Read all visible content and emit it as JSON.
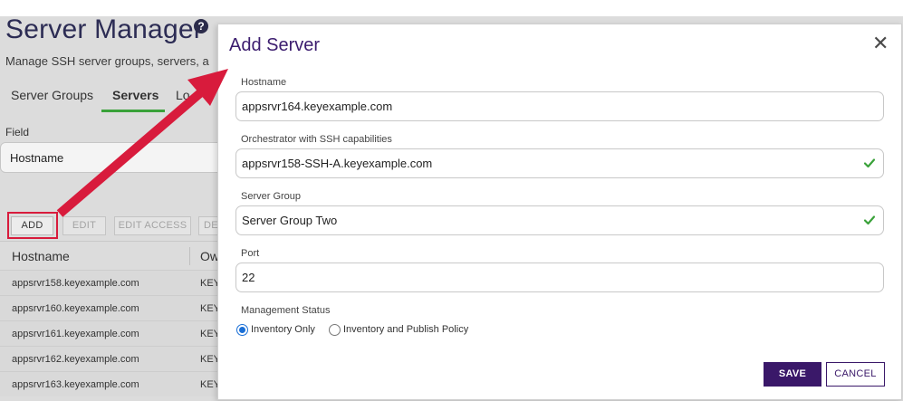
{
  "page": {
    "title": "Server Manager",
    "subtitle": "Manage SSH server groups, servers, a",
    "help_glyph": "?"
  },
  "tabs": [
    {
      "label": "Server Groups",
      "active": false
    },
    {
      "label": "Servers",
      "active": true
    },
    {
      "label": "Lo",
      "active": false
    }
  ],
  "filter": {
    "label": "Field",
    "value": "Hostname"
  },
  "actions": {
    "add": "ADD",
    "edit": "EDIT",
    "edit_access": "EDIT ACCESS",
    "delete_partial": "DE"
  },
  "grid": {
    "columns": [
      "Hostname",
      "Ow"
    ],
    "rows": [
      {
        "hostname": "appsrvr158.keyexample.com",
        "owner": "KEY"
      },
      {
        "hostname": "appsrvr160.keyexample.com",
        "owner": "KEY"
      },
      {
        "hostname": "appsrvr161.keyexample.com",
        "owner": "KEY"
      },
      {
        "hostname": "appsrvr162.keyexample.com",
        "owner": "KEY"
      },
      {
        "hostname": "appsrvr163.keyexample.com",
        "owner": "KEY"
      }
    ]
  },
  "dialog": {
    "title": "Add Server",
    "close_glyph": "✕",
    "fields": {
      "hostname": {
        "label": "Hostname",
        "value": "appsrvr164.keyexample.com"
      },
      "orchestrator": {
        "label": "Orchestrator with SSH capabilities",
        "value": "appsrvr158-SSH-A.keyexample.com"
      },
      "server_group": {
        "label": "Server Group",
        "value": "Server Group Two"
      },
      "port": {
        "label": "Port",
        "value": "22"
      }
    },
    "management_status": {
      "label": "Management Status",
      "options": [
        "Inventory Only",
        "Inventory and Publish Policy"
      ],
      "selected": "Inventory Only"
    },
    "save_label": "SAVE",
    "cancel_label": "CANCEL"
  },
  "colors": {
    "accent_purple": "#3a1869",
    "check_green": "#3aa23a",
    "highlight_red": "#d81b3c",
    "radio_blue": "#1a6fd6"
  },
  "icons": {
    "help": "help-circle-icon",
    "close": "close-icon",
    "valid": "check-icon",
    "annotation": "red-arrow"
  }
}
